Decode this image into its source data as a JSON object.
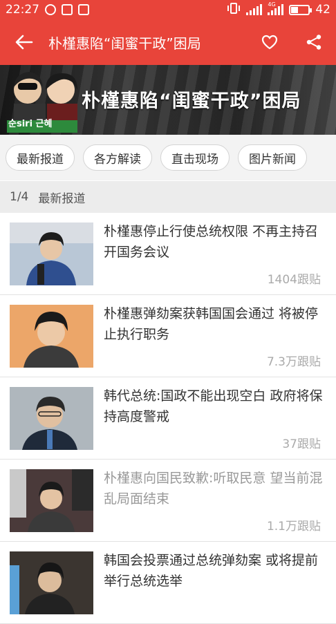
{
  "status": {
    "time": "22:27",
    "battery": "42",
    "battery_level": 0.42,
    "net": "4G"
  },
  "appbar": {
    "title": "朴槿惠陷“闺蜜干政”困局"
  },
  "banner": {
    "title": "朴槿惠陷“闺蜜干政”困局",
    "tag": "순siri 근혜"
  },
  "tabs": [
    "最新报道",
    "各方解读",
    "直击现场",
    "图片新闻"
  ],
  "section": {
    "counter": "1/4",
    "label": "最新报道"
  },
  "news": [
    {
      "title": "朴槿惠停止行使总统权限 不再主持召开国务会议",
      "replies": "1404跟贴",
      "read": false
    },
    {
      "title": "朴槿惠弹劾案获韩国国会通过 将被停止执行职务",
      "replies": "7.3万跟贴",
      "read": false
    },
    {
      "title": "韩代总统:国政不能出现空白 政府将保持高度警戒",
      "replies": "37跟贴",
      "read": false
    },
    {
      "title": "朴槿惠向国民致歉:听取民意 望当前混乱局面结束",
      "replies": "1.1万跟贴",
      "read": true
    },
    {
      "title": "韩国会投票通过总统弹劾案 或将提前举行总统选举",
      "replies": "",
      "read": false
    }
  ]
}
